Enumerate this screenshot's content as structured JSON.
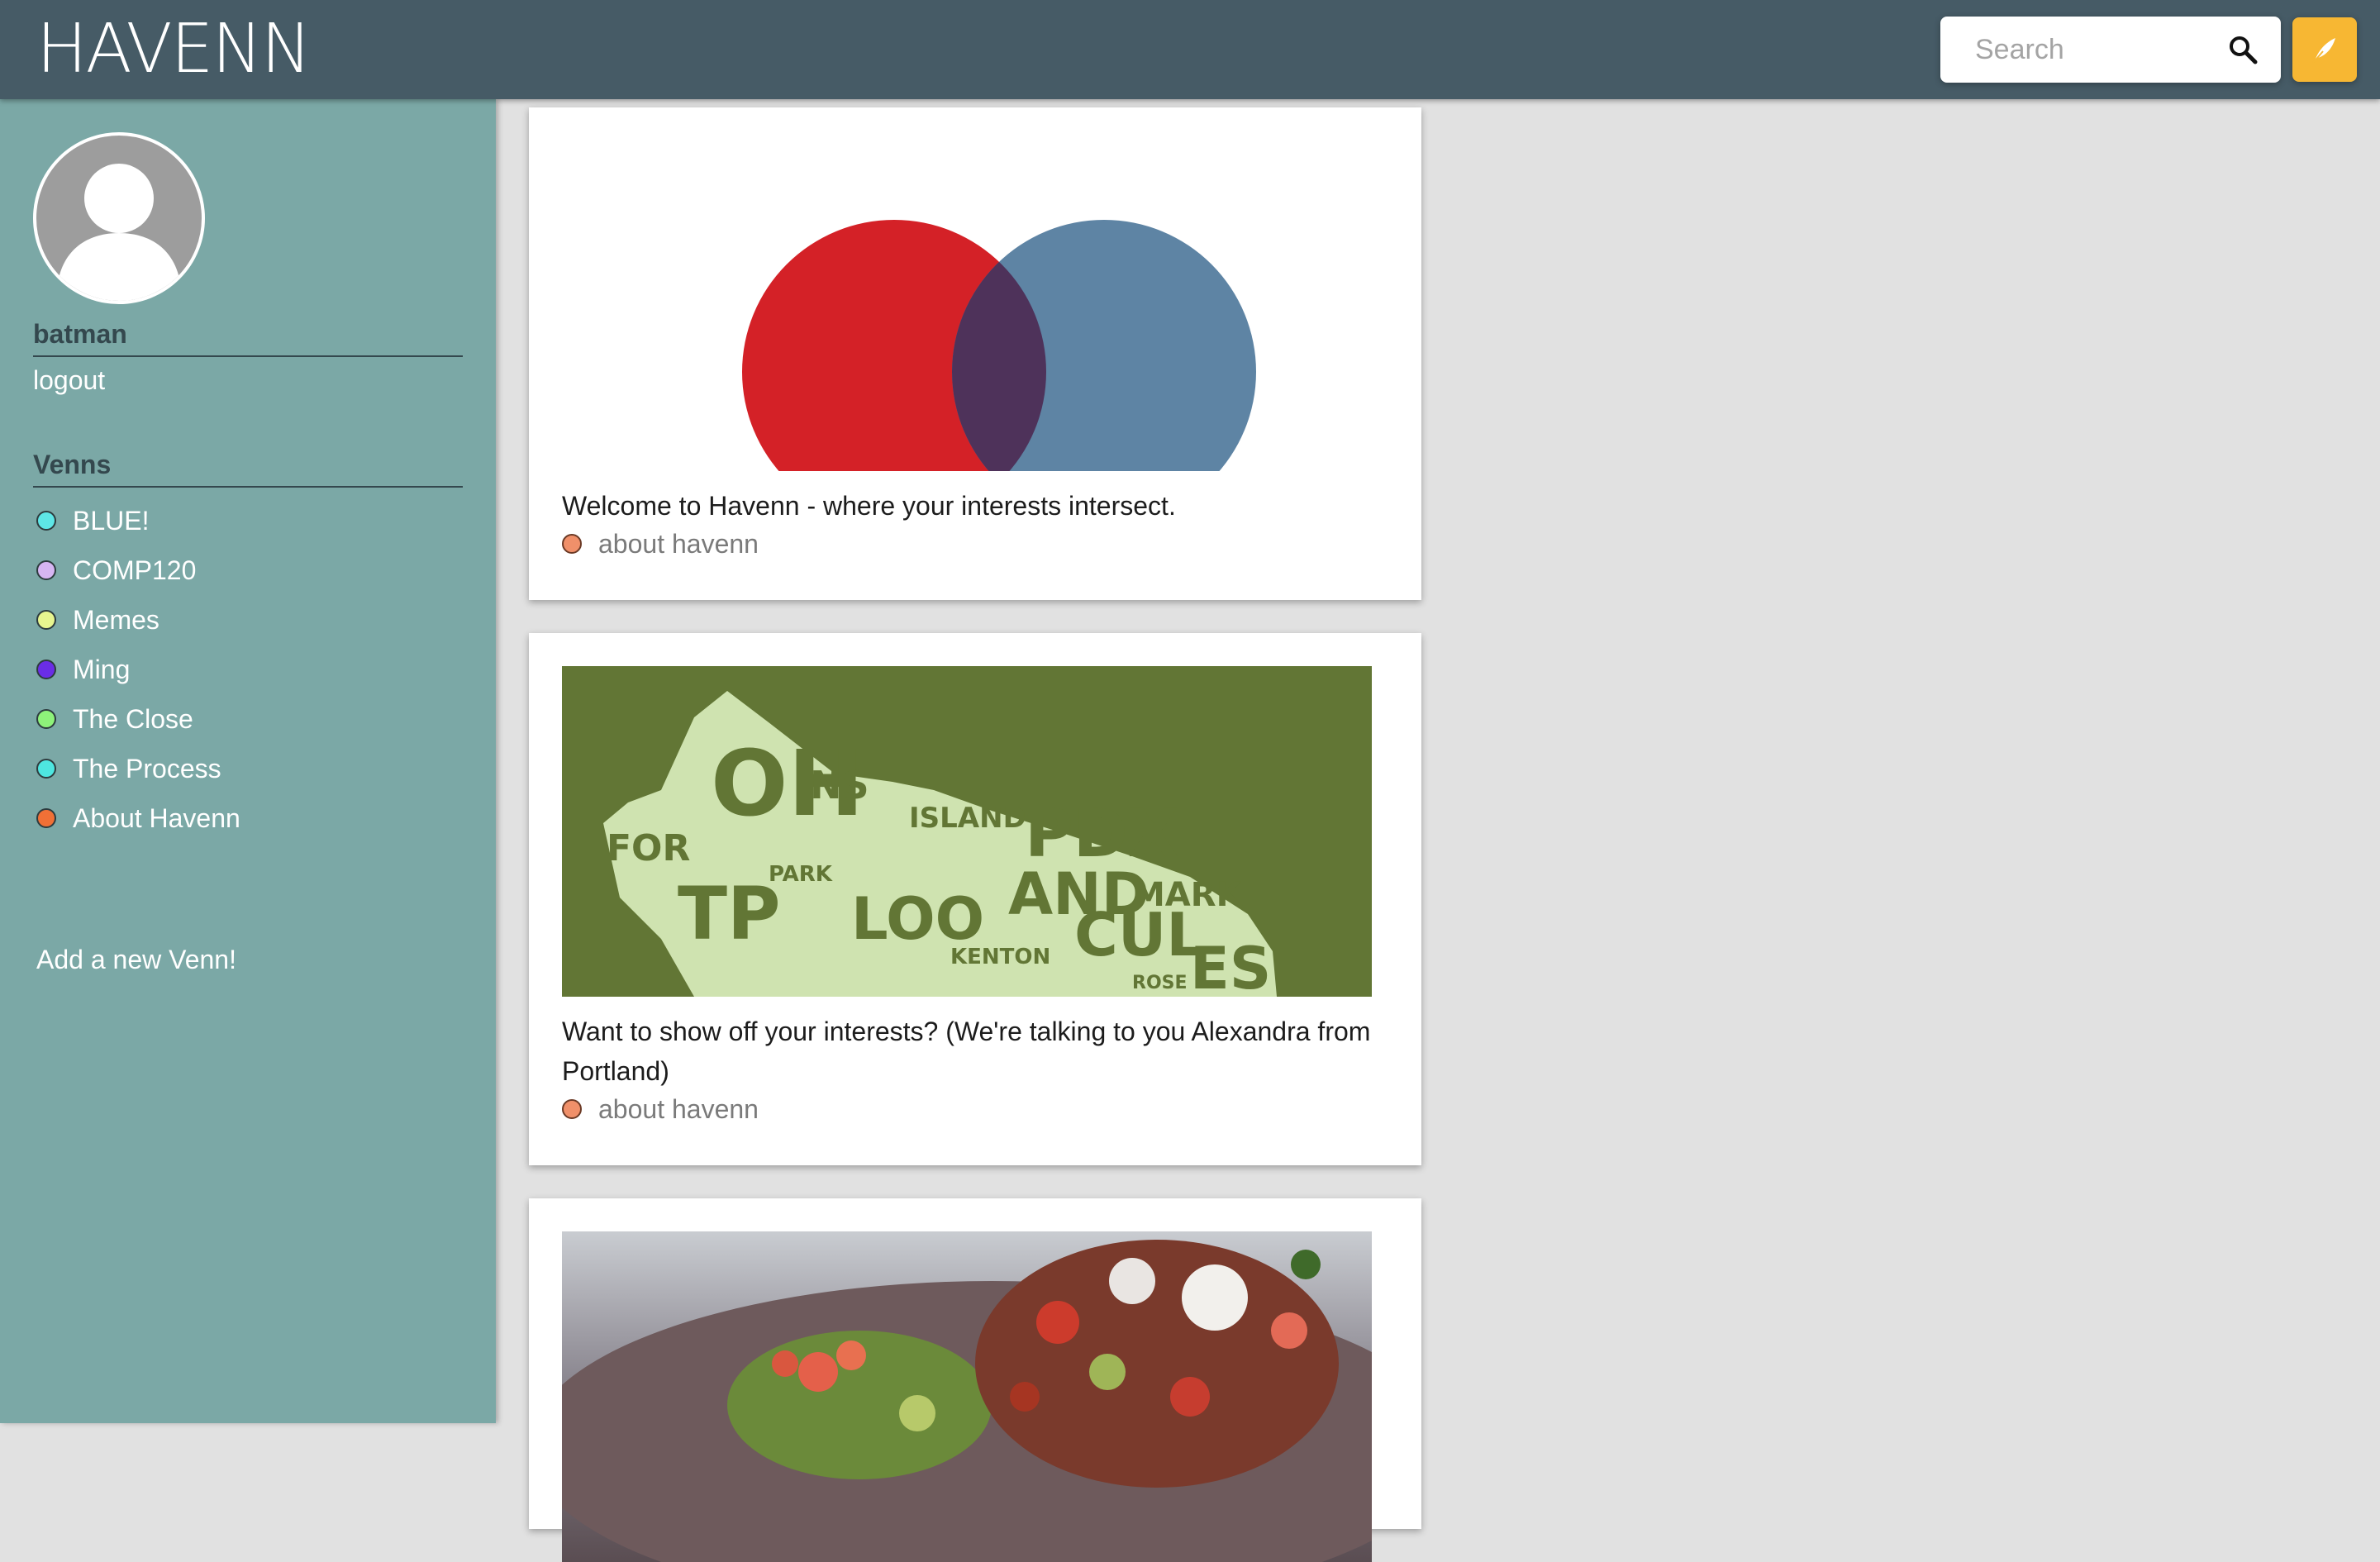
{
  "header": {
    "logo": "HAVENN",
    "search": {
      "placeholder": "Search",
      "value": ""
    },
    "accent_color": "#f7b733",
    "bar_color": "#465b66"
  },
  "sidebar": {
    "username": "batman",
    "logout_label": "logout",
    "venns_heading": "Venns",
    "venns": [
      {
        "label": "BLUE!",
        "color": "#5ee6e6"
      },
      {
        "label": "COMP120",
        "color": "#d6b5f2"
      },
      {
        "label": "Memes",
        "color": "#e7f58f"
      },
      {
        "label": "Ming",
        "color": "#6a2de6"
      },
      {
        "label": "The Close",
        "color": "#8ef27a"
      },
      {
        "label": "The Process",
        "color": "#4ee6e0"
      },
      {
        "label": "About Havenn",
        "color": "#f07036"
      }
    ],
    "add_venn_label": "Add a new Venn!",
    "background_color": "#7ba8a6"
  },
  "feed": {
    "posts": [
      {
        "media": "venn-diagram-image",
        "text": "Welcome to Havenn - where your interests intersect.",
        "tag": {
          "label": "about havenn",
          "color": "#f0906a"
        }
      },
      {
        "media": "portland-neighborhood-map-image",
        "text": "Want to show off your interests? (We're talking to you Alexandra from Portland)",
        "tag": {
          "label": "about havenn",
          "color": "#f0906a"
        }
      },
      {
        "media": "salad-food-photo-image"
      }
    ]
  }
}
